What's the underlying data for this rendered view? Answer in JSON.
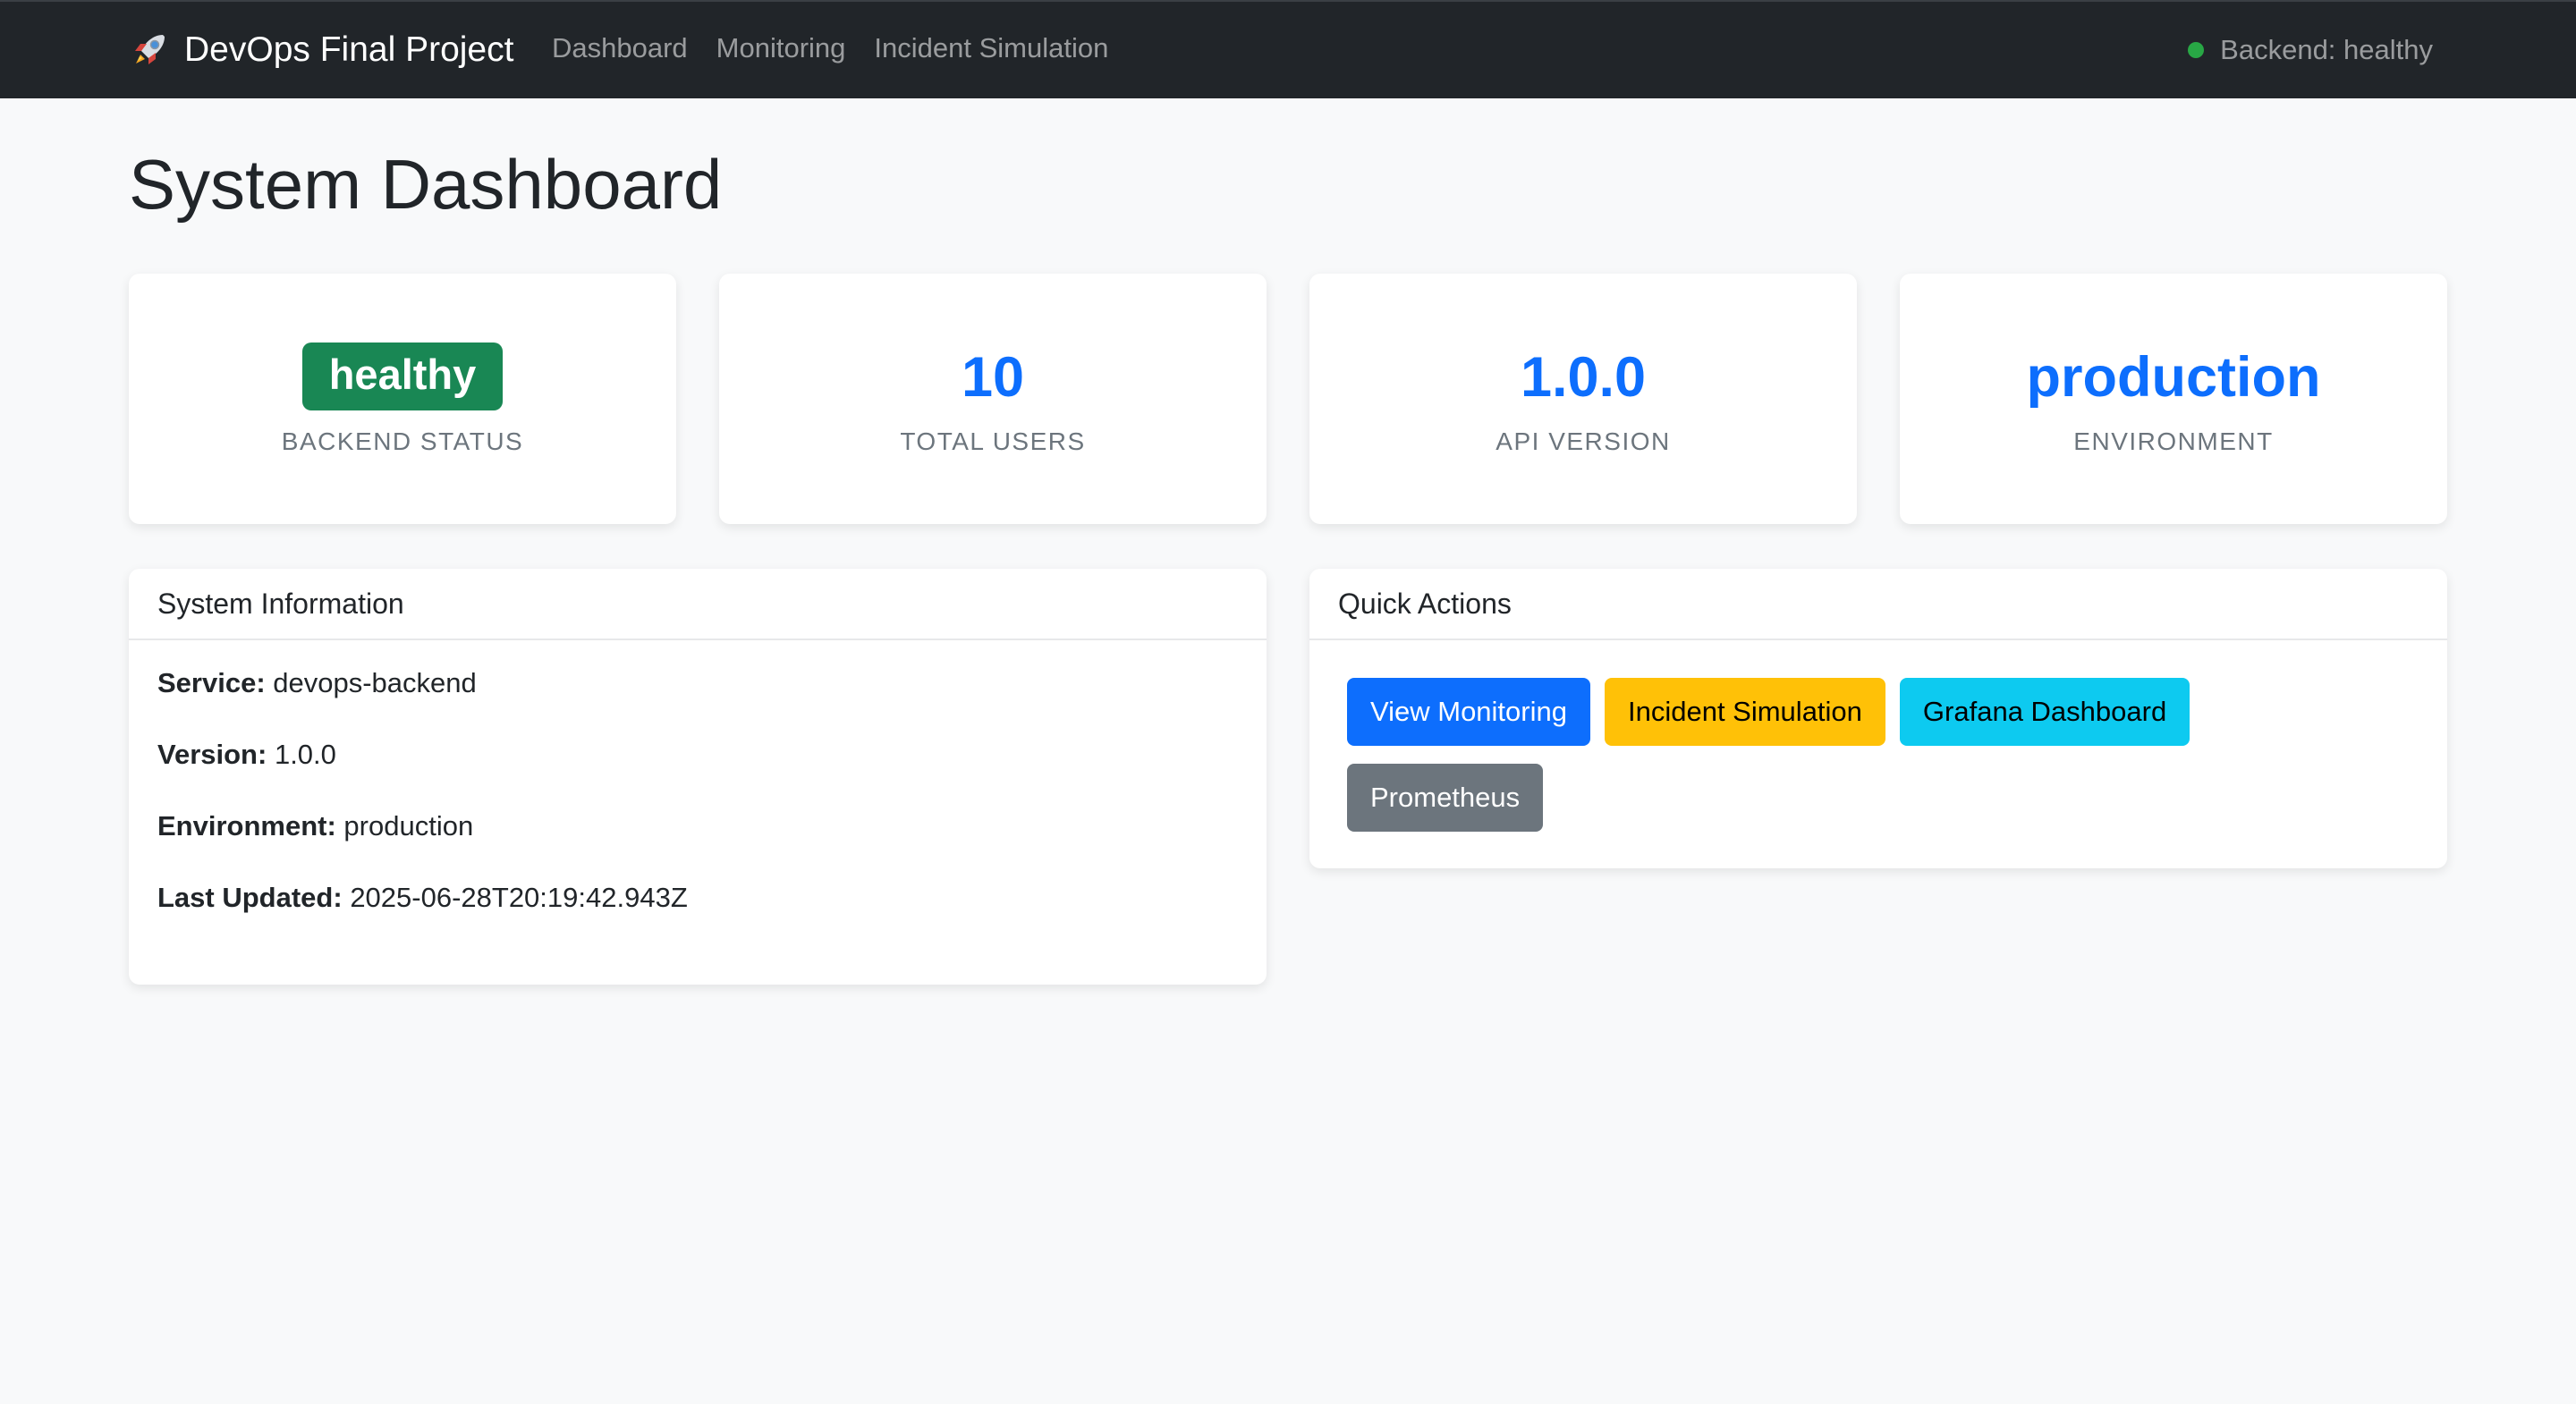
{
  "navbar": {
    "brand": "DevOps Final Project",
    "brand_icon": "rocket-icon",
    "links": [
      {
        "label": "Dashboard"
      },
      {
        "label": "Monitoring"
      },
      {
        "label": "Incident Simulation"
      }
    ],
    "status_text": "Backend: healthy",
    "status_color": "#28a745"
  },
  "page": {
    "title": "System Dashboard"
  },
  "stats": [
    {
      "value": "healthy",
      "label": "BACKEND STATUS",
      "badge_color": "#198754"
    },
    {
      "value": "10",
      "label": "TOTAL USERS",
      "color": "#0d6efd"
    },
    {
      "value": "1.0.0",
      "label": "API VERSION",
      "color": "#0d6efd"
    },
    {
      "value": "production",
      "label": "ENVIRONMENT",
      "color": "#0d6efd"
    }
  ],
  "system_info": {
    "title": "System Information",
    "rows": [
      {
        "key": "Service:",
        "value": "devops-backend"
      },
      {
        "key": "Version:",
        "value": "1.0.0"
      },
      {
        "key": "Environment:",
        "value": "production"
      },
      {
        "key": "Last Updated:",
        "value": "2025-06-28T20:19:42.943Z"
      }
    ]
  },
  "quick_actions": {
    "title": "Quick Actions",
    "buttons": [
      {
        "label": "View Monitoring",
        "bg": "#0d6efd",
        "fg": "#ffffff"
      },
      {
        "label": "Incident Simulation",
        "bg": "#ffc107",
        "fg": "#000000"
      },
      {
        "label": "Grafana Dashboard",
        "bg": "#0dcaf0",
        "fg": "#000000"
      },
      {
        "label": "Prometheus",
        "bg": "#6c757d",
        "fg": "#ffffff"
      }
    ]
  }
}
